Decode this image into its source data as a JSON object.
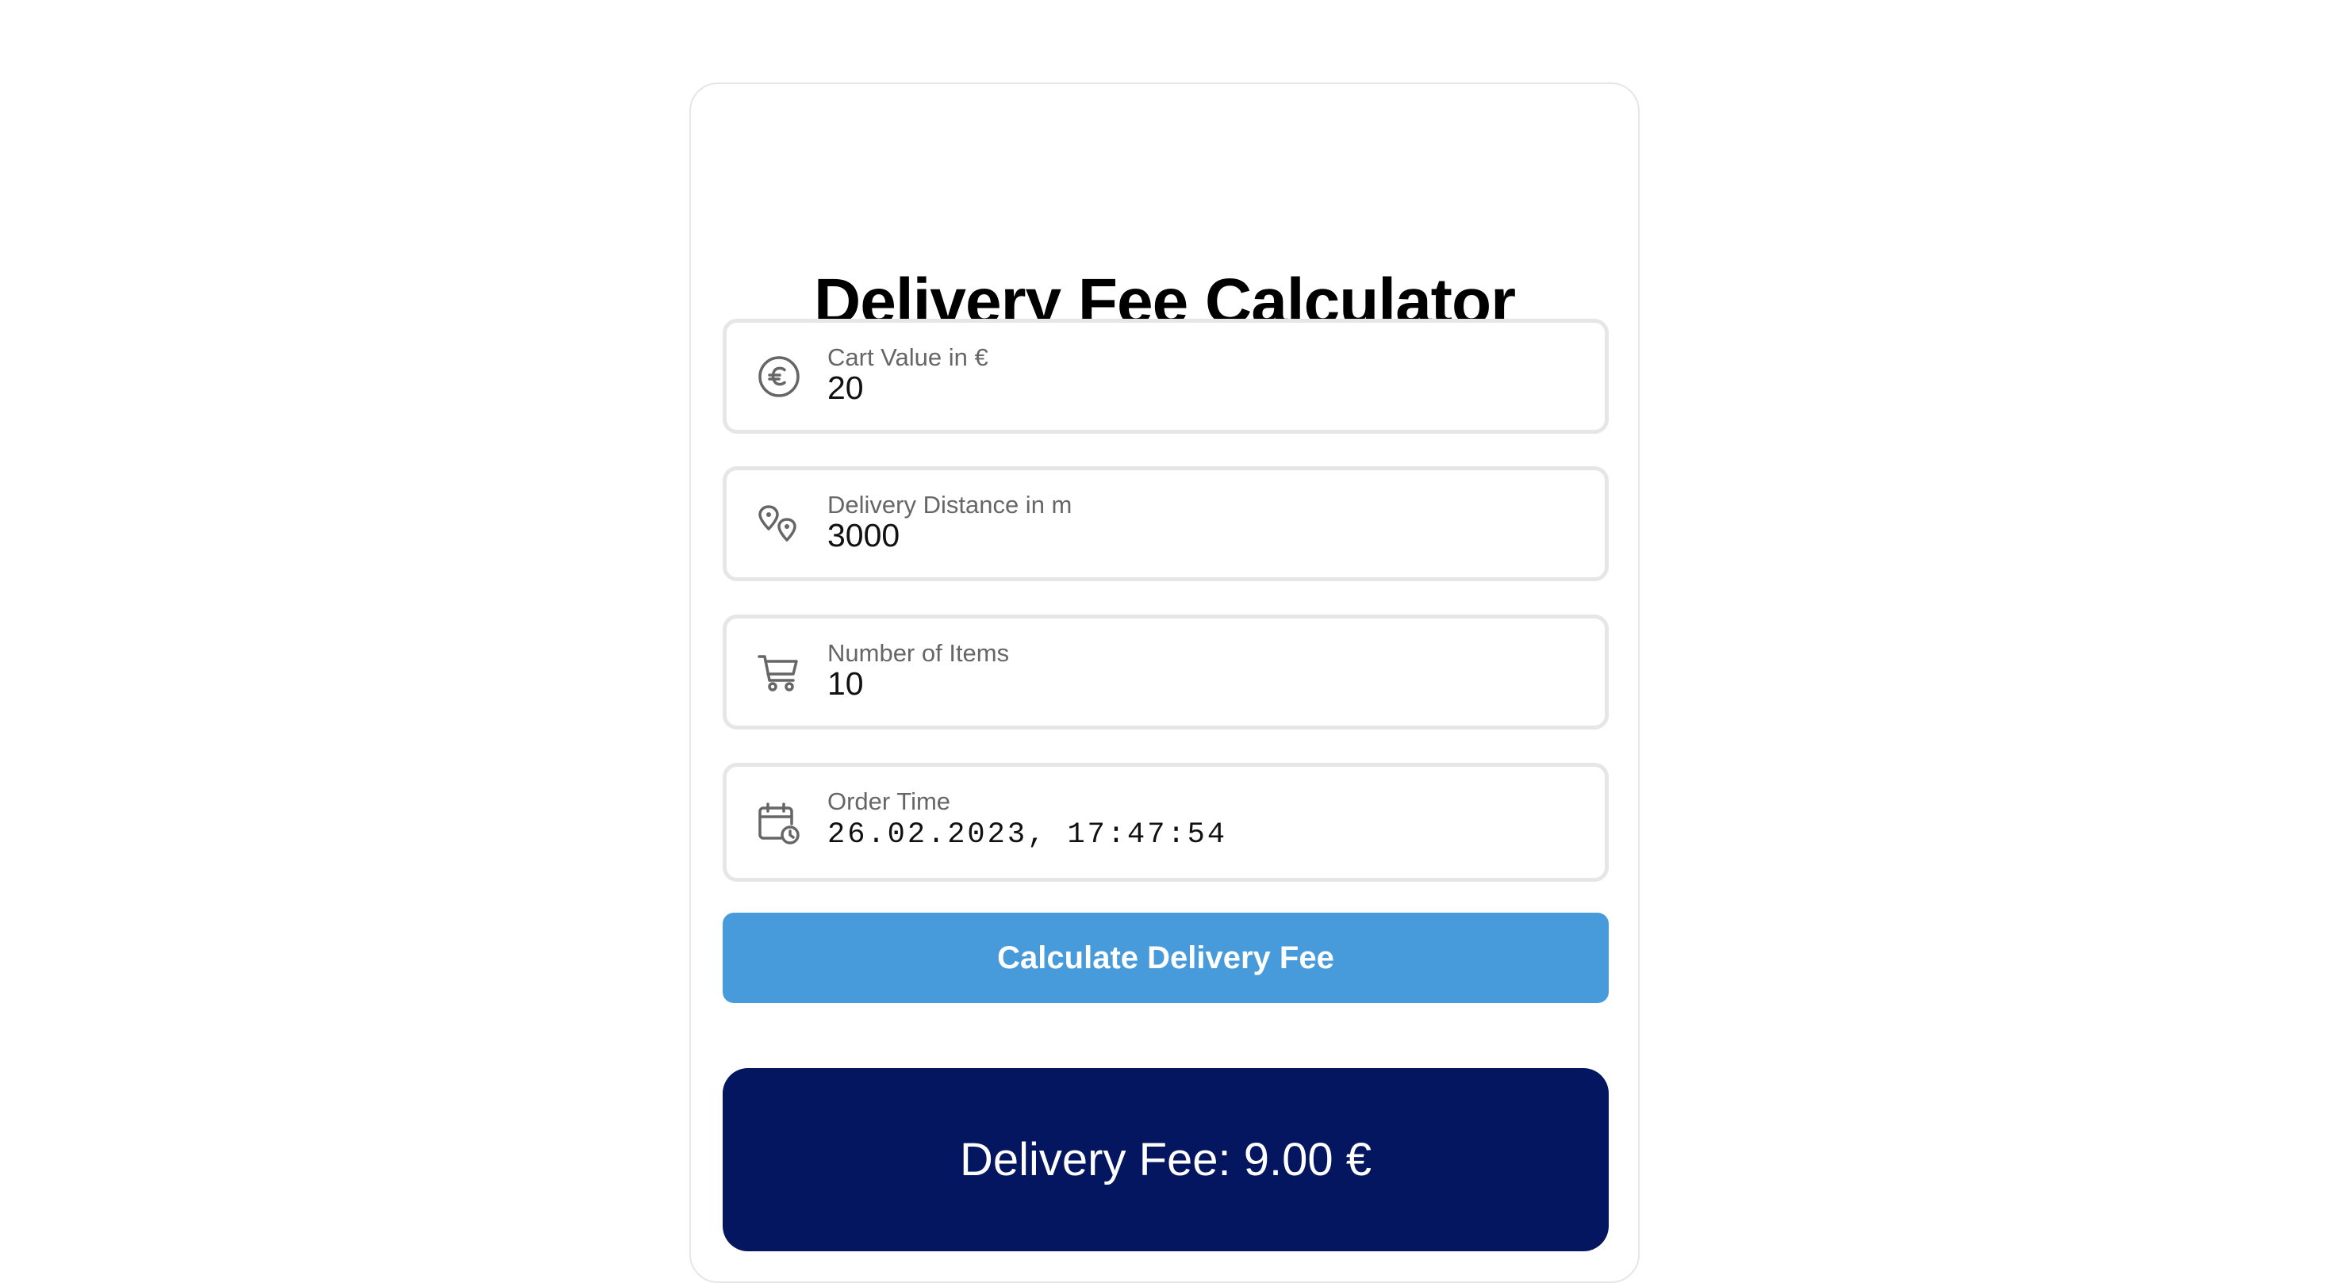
{
  "title": "Delivery Fee Calculator",
  "fields": [
    {
      "label": "Cart Value in €",
      "value": "20",
      "icon": "euro-circle-icon"
    },
    {
      "label": "Delivery Distance in m",
      "value": "3000",
      "icon": "map-pins-icon"
    },
    {
      "label": "Number of Items",
      "value": "10",
      "icon": "cart-icon"
    },
    {
      "label": "Order Time",
      "value": "26.02.2023, 17:47:54",
      "icon": "calendar-clock-icon"
    }
  ],
  "button": {
    "label": "Calculate Delivery Fee"
  },
  "result": {
    "text": "Delivery Fee: 9.00 €"
  },
  "colors": {
    "button": "#489bda",
    "result_background": "#03165f",
    "field_border": "#e6e6e6",
    "label": "#666666"
  }
}
